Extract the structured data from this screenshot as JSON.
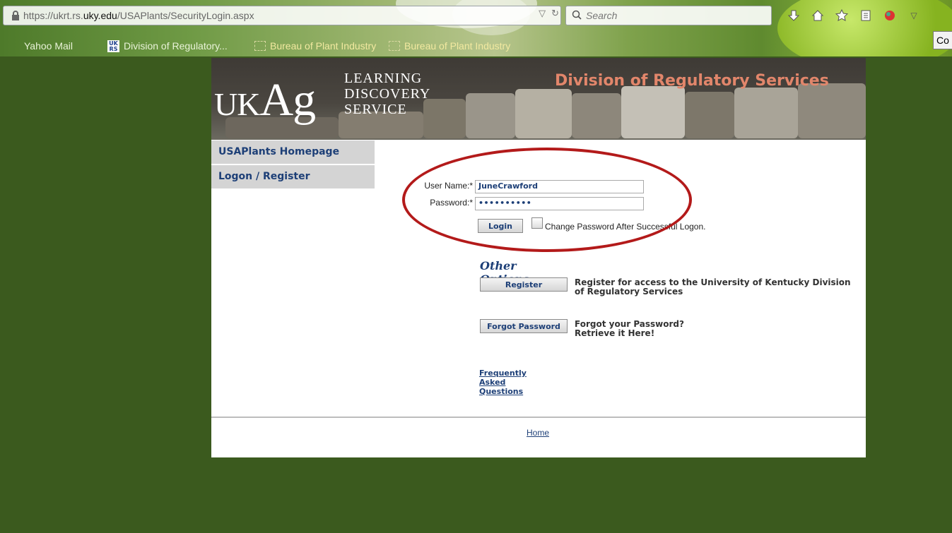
{
  "browser": {
    "url_prefix": "https://ukrt.rs.",
    "url_domain": "uky.edu",
    "url_path": "/USAPlants/SecurityLogin.aspx",
    "search_placeholder": "Search",
    "tooltip_text": "Co",
    "bookmarks": [
      {
        "label": "Yahoo Mail"
      },
      {
        "label": "Division of Regulatory...",
        "icon_text": "UK RS"
      },
      {
        "label": "Bureau of Plant Industry"
      },
      {
        "label": "Bureau of Plant Industry"
      }
    ]
  },
  "banner": {
    "logo_uk": "UK",
    "logo_ag": "Ag",
    "tagline": [
      "LEARNING",
      "DISCOVERY",
      "SERVICE"
    ],
    "division_title": "Division of Regulatory Services"
  },
  "sidenav": {
    "items": [
      {
        "label": "USAPlants Homepage"
      },
      {
        "label": "Logon / Register"
      }
    ]
  },
  "login": {
    "username_label": "User Name:*",
    "username_value": "JuneCrawford",
    "password_label": "Password:*",
    "password_value": "••••••••••",
    "login_button": "Login",
    "change_password_label": "Change Password After Successful Logon."
  },
  "other_options": {
    "title": "Other Options",
    "register_button": "Register",
    "register_desc_line1": "Register for access to the University of Kentucky Division",
    "register_desc_line2": "of Regulatory Services",
    "forgot_button": "Forgot Password",
    "forgot_desc_line1": "Forgot your Password?",
    "forgot_desc_line2": "Retrieve it Here!",
    "faq_link": "Frequently Asked Questions"
  },
  "footer": {
    "home_link": "Home"
  },
  "colors": {
    "page_background": "#3b5a1e",
    "annotation_circle": "#b31a1a",
    "link_blue": "#1d3f77",
    "division_title": "#e2866b"
  }
}
